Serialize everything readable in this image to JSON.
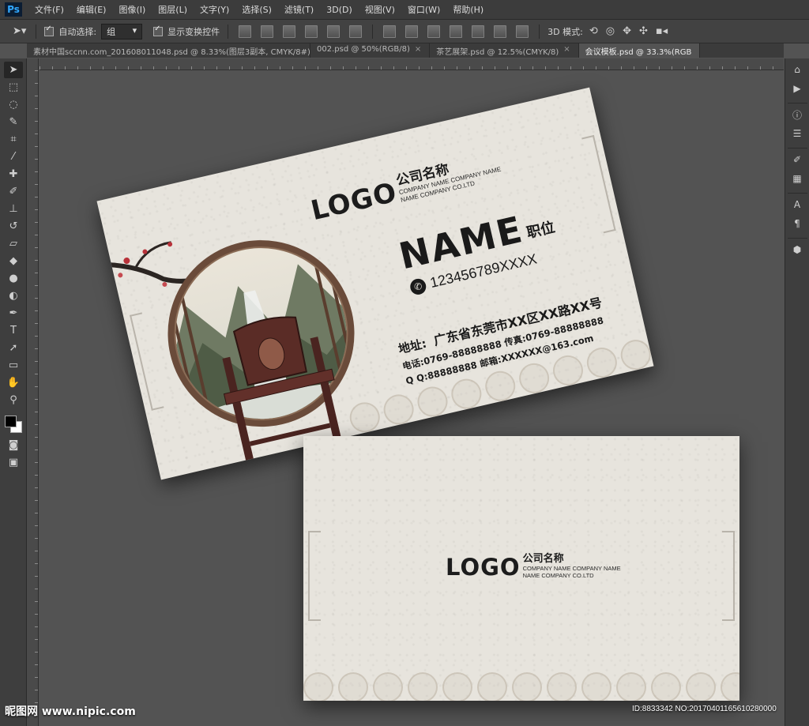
{
  "app": {
    "logo": "Ps"
  },
  "menu": [
    "文件(F)",
    "编辑(E)",
    "图像(I)",
    "图层(L)",
    "文字(Y)",
    "选择(S)",
    "滤镜(T)",
    "3D(D)",
    "视图(V)",
    "窗口(W)",
    "帮助(H)"
  ],
  "options": {
    "auto_select_label": "自动选择:",
    "auto_select_value": "组",
    "show_transform_label": "显示变换控件",
    "mode_3d_label": "3D 模式:"
  },
  "tabs": [
    {
      "label": "素材中国sccnn.com_201608011048.psd @ 8.33%(图层3副本, CMYK/8#) *",
      "active": false
    },
    {
      "label": "002.psd @ 50%(RGB/8)",
      "active": false
    },
    {
      "label": "茶艺展架.psd @ 12.5%(CMYK/8)",
      "active": false
    },
    {
      "label": "会议模板.psd @ 33.3%(RGB",
      "active": true
    }
  ],
  "front_card": {
    "logo": "LOGO",
    "company_cn": "公司名称",
    "company_en_1": "COMPANY NAME COMPANY NAME",
    "company_en_2": "NAME COMPANY CO.LTD",
    "name": "NAME",
    "title": "职位",
    "phone": "123456789XXXX",
    "address_label": "地址:",
    "address": "广东省东莞市XX区XX路XX号",
    "tel_line": "电话:0769-88888888  传真:0769-88888888",
    "qq_line": "Q Q:88888888  邮箱:XXXXXX@163.com"
  },
  "back_card": {
    "logo": "LOGO",
    "company_cn": "公司名称",
    "company_en_1": "COMPANY NAME COMPANY NAME",
    "company_en_2": "NAME COMPANY CO.LTD"
  },
  "watermark": {
    "site": "昵图网 www.nipic.com",
    "id": "ID:8833342 NO:20170401165610280000"
  },
  "colors": {
    "workspace": "#535353",
    "card_paper": "#e7e4dd",
    "medallion_frame": "#6a4b3a",
    "text_dark": "#1a1a1a"
  }
}
